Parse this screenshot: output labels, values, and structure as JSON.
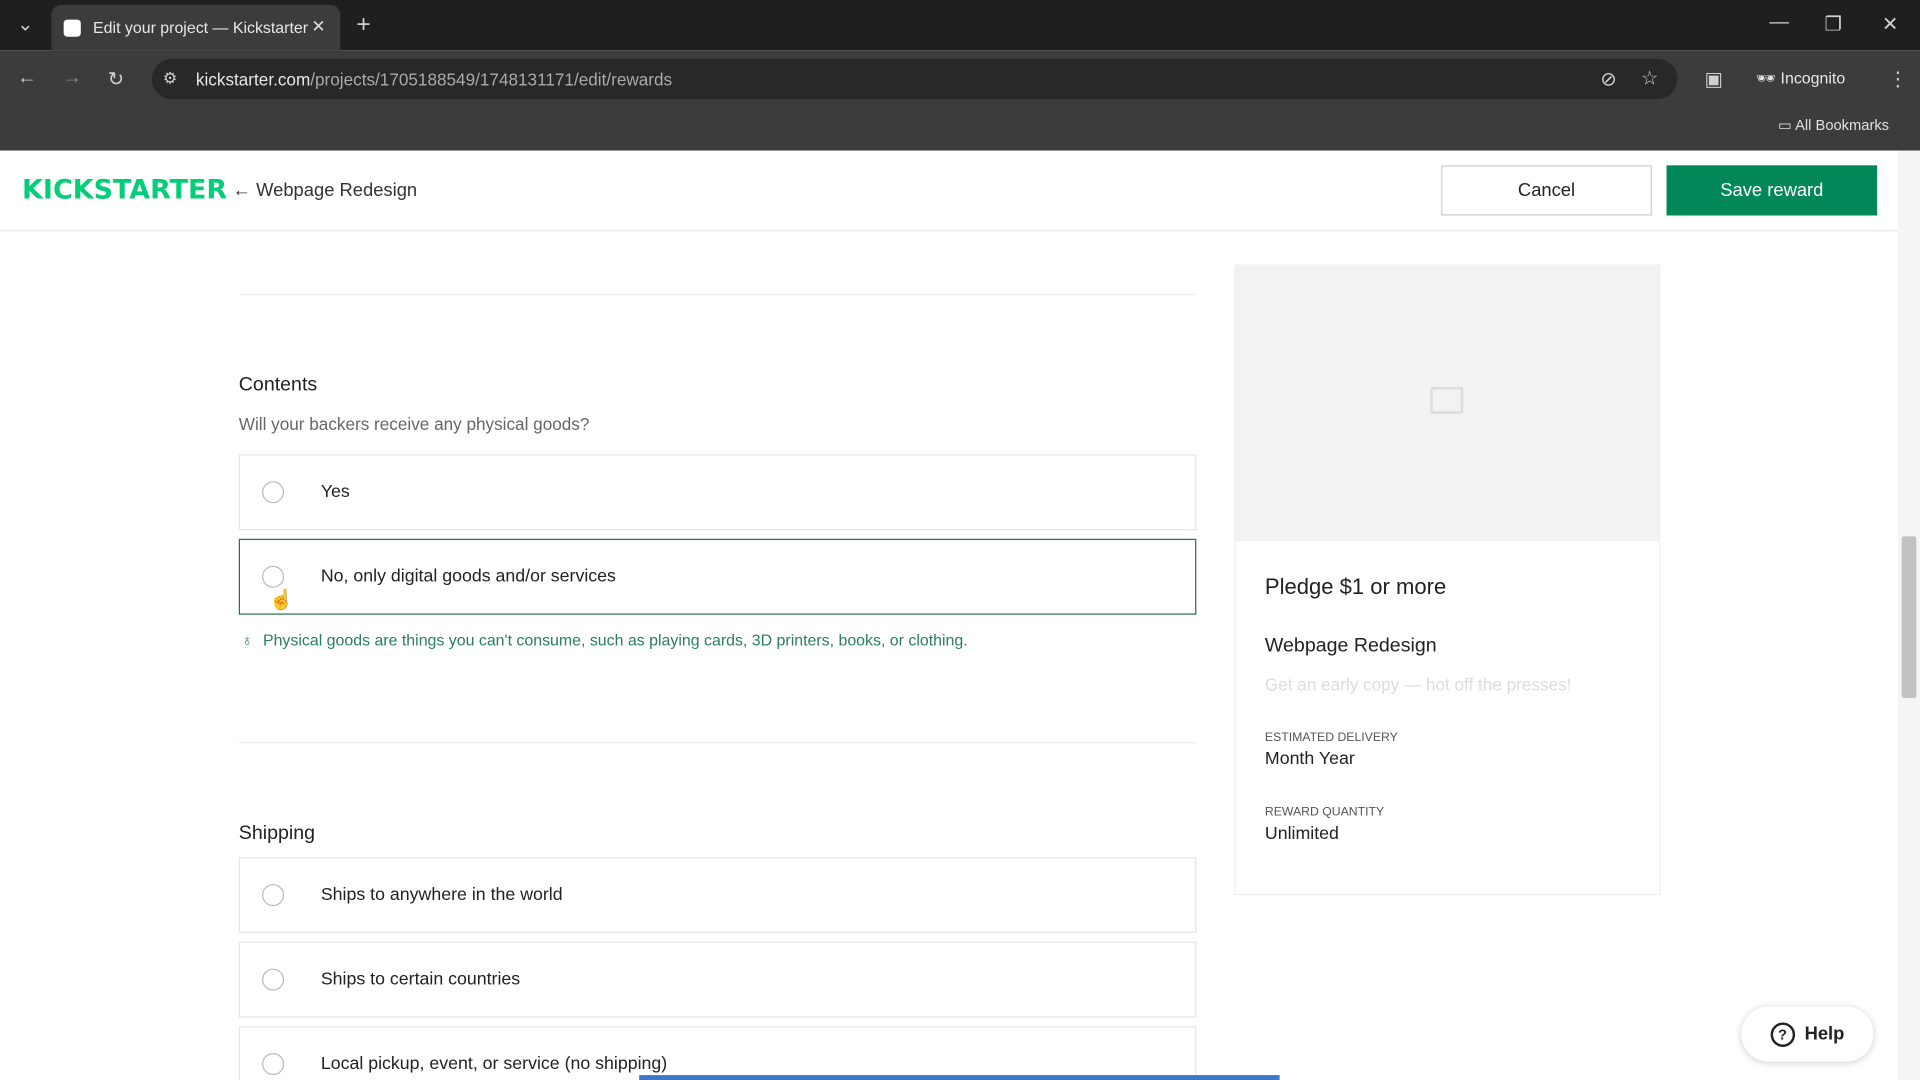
{
  "browser": {
    "tab_title": "Edit your project — Kickstarter",
    "url_host": "kickstarter.com",
    "url_path": "/projects/1705188549/1748131171/edit/rewards",
    "incognito": "Incognito",
    "bookmarks": "All Bookmarks"
  },
  "header": {
    "logo": "KICKSTARTER",
    "back_label": "← Webpage Redesign",
    "cancel": "Cancel",
    "save": "Save reward",
    "accent": "#05ce78",
    "save_color": "#028858"
  },
  "contents": {
    "title": "Contents",
    "question": "Will your backers receive any physical goods?",
    "options": [
      {
        "label": "Yes"
      },
      {
        "label": "No, only digital goods and/or services"
      }
    ],
    "tip": "Physical goods are things you can't consume, such as playing cards, 3D printers, books, or clothing."
  },
  "shipping": {
    "title": "Shipping",
    "options": [
      {
        "label": "Ships to anywhere in the world"
      },
      {
        "label": "Ships to certain countries"
      },
      {
        "label": "Local pickup, event, or service (no shipping)"
      }
    ]
  },
  "preview": {
    "pledge": "Pledge $1 or more",
    "title": "Webpage Redesign",
    "description_placeholder": "Get an early copy — hot off the presses!",
    "delivery_label": "Estimated delivery",
    "delivery_value": "Month Year",
    "quantity_label": "Reward quantity",
    "quantity_value": "Unlimited"
  },
  "help": {
    "label": "Help"
  }
}
